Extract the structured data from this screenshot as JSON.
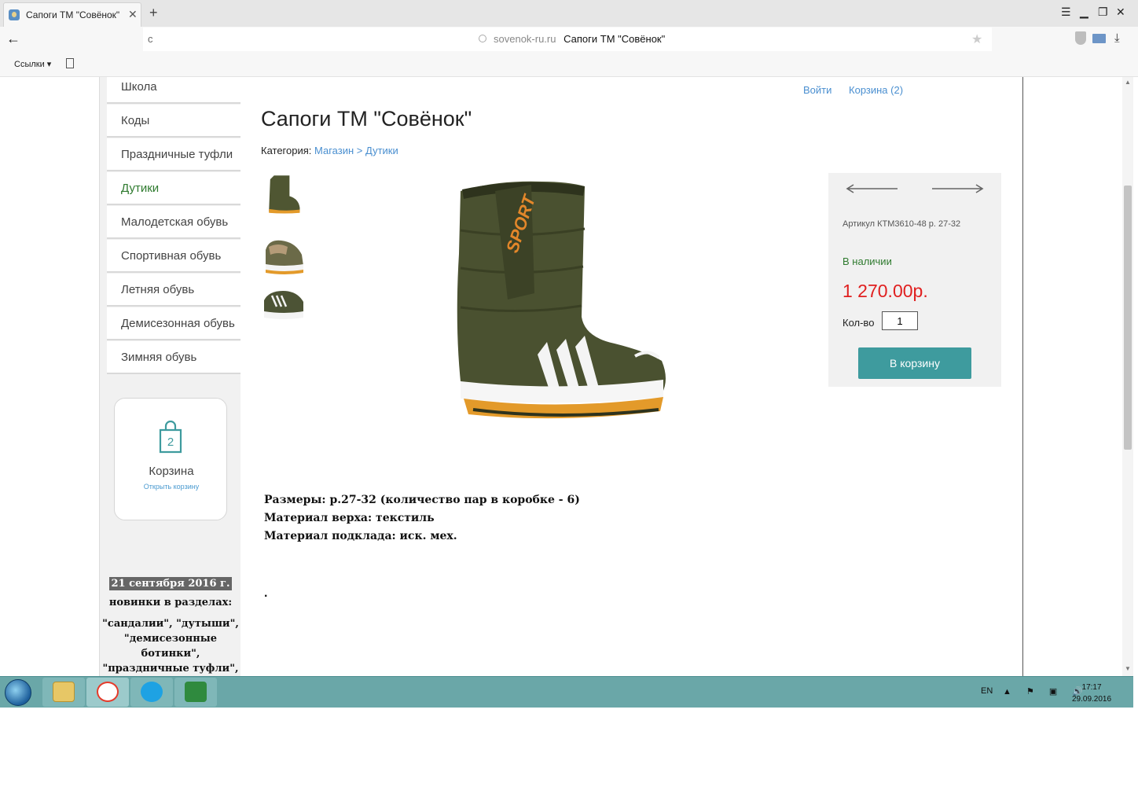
{
  "browser": {
    "tab_title": "Сапоги ТМ \"Совёнок\"",
    "tab_close": "✕",
    "new_tab": "+",
    "window_controls": [
      "☰",
      "▁",
      "❐",
      "✕"
    ],
    "back": "←",
    "reload": "c",
    "url_domain": "sovenok-ru.ru",
    "url_page_title": "Сапоги ТМ \"Совёнок\"",
    "star": "★",
    "download": "⤓",
    "bookmarks_label": "Ссылки ▾",
    "icons": [
      "favicon-icon",
      "shield-icon",
      "mail-icon",
      "download-icon",
      "page-icon",
      "globe-icon"
    ]
  },
  "sidebar": {
    "categories": [
      {
        "label": "Школа",
        "active": false
      },
      {
        "label": "Коды",
        "active": false
      },
      {
        "label": "Праздничные туфли",
        "active": false
      },
      {
        "label": "Дутики",
        "active": true
      },
      {
        "label": "Малодетская обувь",
        "active": false
      },
      {
        "label": "Спортивная обувь",
        "active": false
      },
      {
        "label": "Летняя обувь",
        "active": false
      },
      {
        "label": "Демисезонная обувь",
        "active": false
      },
      {
        "label": "Зимняя обувь",
        "active": false
      }
    ],
    "cart": {
      "count": "2",
      "label": "Корзина",
      "link": "Открыть корзину"
    },
    "news": {
      "date": "21 сентября 2016 г.",
      "heading": "новинки в разделах:",
      "tags": "\"сандалии\", \"дутыши\", \"демисезонные ботинки\", \"праздничные туфли\","
    }
  },
  "header": {
    "login": "Войти",
    "cart_link": "Корзина (2)"
  },
  "product": {
    "title": "Сапоги ТМ \"Совёнок\"",
    "category_label": "Категория:",
    "breadcrumb": "Магазин > Дутики",
    "sku": "Артикул КТМ3610-48 р. 27-32",
    "stock": "В наличии",
    "price": "1 270.00р.",
    "qty_label": "Кол-во",
    "qty_value": "1",
    "buy_label": "В корзину",
    "specs": [
      "Размеры: р.27-32 (количество пар в коробке - 6)",
      "Материал верха: текстиль",
      "Материал подклада: иск. мех."
    ],
    "trailing_dot": ".",
    "colors": {
      "accent": "#3e9b9e",
      "price": "#e02020",
      "stock": "#2e7a2e",
      "link": "#4a8fd0"
    }
  },
  "taskbar": {
    "apps": [
      "windows-start-icon",
      "file-explorer-icon",
      "yandex-browser-icon",
      "skype-icon",
      "excel-icon"
    ],
    "lang": "EN",
    "tray": "▲ ⚑ ▣ 🔊",
    "time": "17:17",
    "date": "29.09.2016"
  }
}
